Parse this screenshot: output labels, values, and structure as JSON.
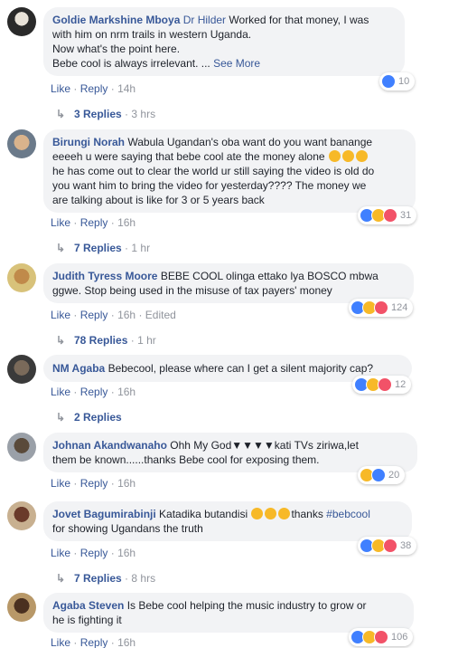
{
  "actions": {
    "like": "Like",
    "reply": "Reply",
    "dot": "·"
  },
  "comments": [
    {
      "author": "Goldie Markshine Mboya",
      "mention": "Dr Hilder",
      "text_lines": [
        "Worked for that money, I was",
        "with him on nrm trails in western Uganda.",
        "Now what's the point here.",
        "Bebe cool is always irrelevant. ... "
      ],
      "see_more": "See More",
      "time": "14h",
      "reaction_count": "10",
      "replies_label": "3 Replies",
      "replies_time": "3 hrs"
    },
    {
      "author": "Birungi Norah",
      "text_lines": [
        "Wabula Ugandan's oba want do you want banange",
        "eeeeh u were saying that bebe cool ate the money alone",
        "he has come out to clear the world ur still saying the video is old do",
        "you want him to bring the video for yesterday???? The money we",
        "are talking about is like for 3 or 5 years back"
      ],
      "time": "16h",
      "reaction_count": "31",
      "replies_label": "7 Replies",
      "replies_time": "1 hr"
    },
    {
      "author": "Judith Tyress Moore",
      "text_lines": [
        "BEBE COOL olinga ettako lya BOSCO mbwa",
        "ggwe. Stop being used in the misuse of tax payers' money"
      ],
      "time": "16h",
      "edited": "Edited",
      "reaction_count": "124",
      "replies_label": "78 Replies",
      "replies_time": "1 hr"
    },
    {
      "author": "NM Agaba",
      "text_lines": [
        "Bebecool, please where can I get a silent majority cap?"
      ],
      "time": "16h",
      "reaction_count": "12",
      "replies_label": "2 Replies"
    },
    {
      "author": "Johnan Akandwanaho",
      "text_lines": [
        "Ohh My God▼▼▼▼kati TVs ziriwa,let",
        "them be known......thanks Bebe cool for exposing them."
      ],
      "time": "16h",
      "reaction_count": "20"
    },
    {
      "author": "Jovet Bagumirabinji",
      "text_lines": [
        "Katadika butandisi",
        "thanks ",
        "for showing Ugandans the truth"
      ],
      "hashtag": "#bebcool",
      "time": "16h",
      "reaction_count": "38",
      "replies_label": "7 Replies",
      "replies_time": "8 hrs"
    },
    {
      "author": "Agaba Steven",
      "text_lines": [
        "Is Bebe cool helping the music industry to grow or",
        "he is fighting it"
      ],
      "time": "16h",
      "reaction_count": "106"
    }
  ]
}
